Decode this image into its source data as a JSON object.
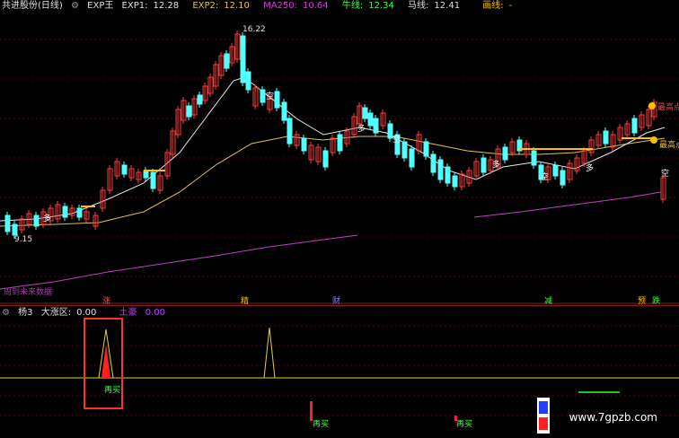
{
  "top": {
    "title": "共进股份(日线)",
    "indicator": "EXP王",
    "exp1_label": "EXP1:",
    "exp1_value": "12.28",
    "exp2_label": "EXP2:",
    "exp2_value": "12.10",
    "ma_label": "MA250:",
    "ma_value": "10.64",
    "niu_label": "牛线:",
    "niu_value": "12.34",
    "ma2_label": "马线:",
    "ma2_value": "12.41",
    "draw_label": "画线:",
    "draw_value": "-",
    "high_price": "16.22",
    "low_price": "9.15",
    "future_text": "周到未来数据",
    "labels_kong": "空",
    "labels_duo": "多",
    "high_marker_1": "最高点",
    "high_marker_2": "最高点",
    "bottom_tags": [
      "涨",
      "精",
      "财",
      "减",
      "预",
      "跌"
    ],
    "colors": {
      "up": "#ff3b3b",
      "down": "#54ffff",
      "ma_white": "#e8e8e8",
      "ma_yellow": "#e0c050",
      "ma250": "#c040c0",
      "gold": "#ffc000"
    }
  },
  "bottom": {
    "name": "杨3",
    "zone_label": "大涨区:",
    "zone_value": "0.00",
    "lb_label": "土豪",
    "lb_value": "0.00",
    "buy_label_1": "再买",
    "buy_label_2": "再买",
    "buy_label_3": "再买"
  },
  "watermark": "www.7gpzb.com"
}
